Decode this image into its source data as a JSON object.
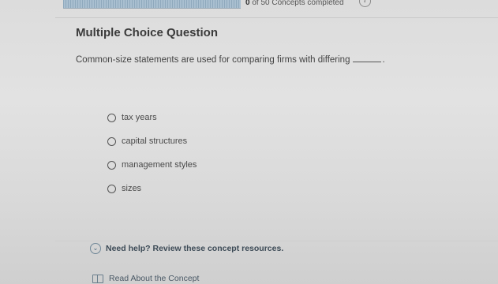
{
  "progress": {
    "completed_count": "0",
    "suffix": "of 50 Concepts completed",
    "fraction": 0
  },
  "header": {
    "info_icon": "info-icon"
  },
  "question": {
    "title": "Multiple Choice Question",
    "prompt": "Common-size statements are used for comparing firms with differing",
    "trailing": "."
  },
  "options": [
    {
      "label": "tax years",
      "selected": false
    },
    {
      "label": "capital structures",
      "selected": false
    },
    {
      "label": "management styles",
      "selected": false
    },
    {
      "label": "sizes",
      "selected": false
    }
  ],
  "help": {
    "text": "Need help? Review these concept resources.",
    "icon": "chevron-down-icon"
  },
  "resources": [
    {
      "label": "Read About the Concept",
      "icon": "book-icon"
    }
  ]
}
